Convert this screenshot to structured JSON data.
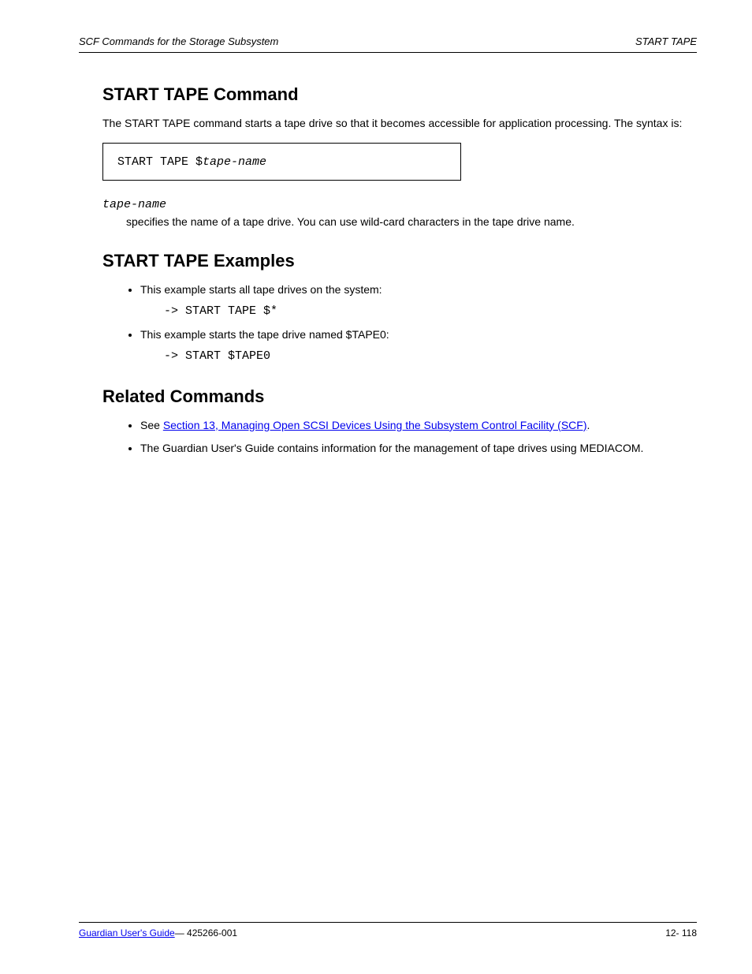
{
  "header": {
    "left": "SCF Commands for the Storage Subsystem",
    "right": "START TAPE"
  },
  "section1": {
    "title": "START TAPE Command",
    "intro": "The START TAPE command starts a tape drive so that it becomes accessible for application processing. The syntax is:",
    "syntax_plain": "START TAPE $",
    "syntax_ital": "tape-name",
    "param_term": "tape-name",
    "param_def": "specifies the name of a tape drive. You can use wild-card characters in the tape drive name."
  },
  "section2": {
    "title": "START TAPE Examples",
    "items": [
      {
        "text": "This example starts all tape drives on the system:",
        "cmd": "-> START TAPE $*"
      },
      {
        "text": "This example starts the tape drive named $TAPE0:",
        "cmd": "-> START $TAPE0"
      }
    ]
  },
  "section3": {
    "title": "Related Commands",
    "items": [
      {
        "prefix": "See ",
        "link": "Section 13, Managing Open SCSI Devices Using the Subsystem Control Facility (SCF)",
        "suffix": "."
      },
      {
        "prefix": "The Guardian User's Guide contains information for the management of tape drives using MEDIACOM.",
        "link": null,
        "suffix": ""
      }
    ]
  },
  "footer": {
    "left_title": "Guardian User's Guide",
    "left_id": "— 425266-001",
    "page": "12- 118"
  }
}
